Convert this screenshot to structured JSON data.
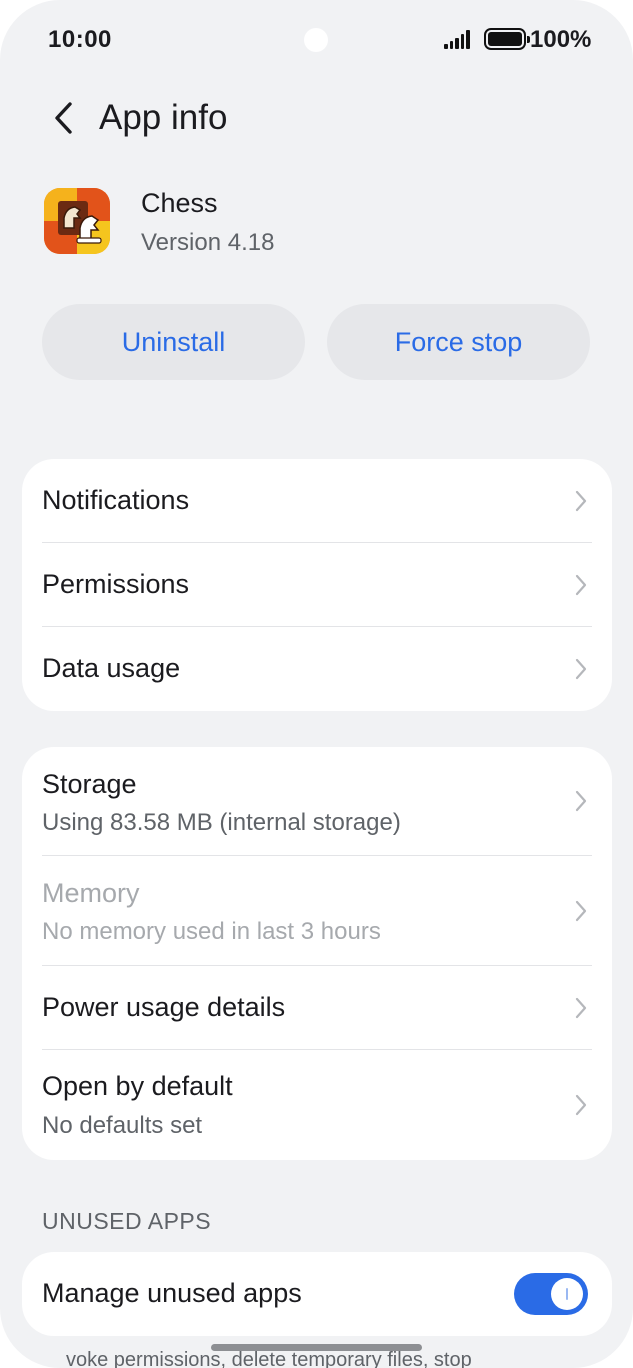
{
  "status_bar": {
    "time": "10:00",
    "battery_percent": "100%"
  },
  "header": {
    "title": "App info"
  },
  "app": {
    "name": "Chess",
    "version": "Version 4.18"
  },
  "actions": {
    "uninstall_label": "Uninstall",
    "force_stop_label": "Force stop"
  },
  "group1": {
    "notifications": "Notifications",
    "permissions": "Permissions",
    "data_usage": "Data usage"
  },
  "group2": {
    "storage": {
      "label": "Storage",
      "sub": "Using 83.58 MB (internal storage)"
    },
    "memory": {
      "label": "Memory",
      "sub": "No memory used in last 3 hours"
    },
    "power": {
      "label": "Power usage details"
    },
    "open_default": {
      "label": "Open by default",
      "sub": "No defaults set"
    }
  },
  "unused_apps": {
    "section_title": "UNUSED APPS",
    "manage_label": "Manage unused apps",
    "toggle_on": true,
    "footnote": "voke permissions, delete temporary files, stop"
  },
  "colors": {
    "accent": "#2a6be6",
    "background": "#f1f2f4",
    "card": "#ffffff"
  }
}
